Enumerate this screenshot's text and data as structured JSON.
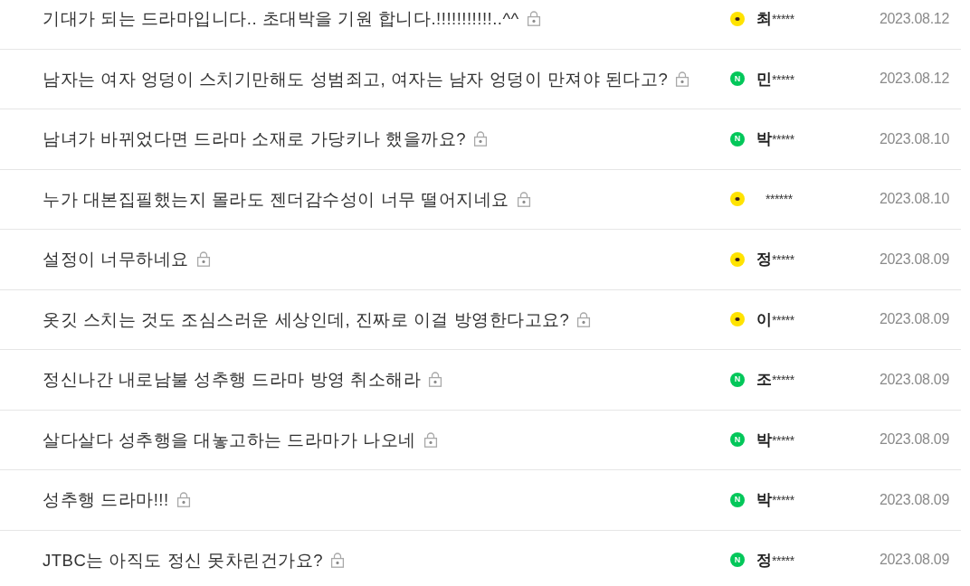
{
  "posts": [
    {
      "title": "기대가 되는 드라마입니다.. 초대박을 기원 합니다.!!!!!!!!!!!..^^",
      "locked": true,
      "author": {
        "kind": "dot",
        "initial": "최",
        "mask": "*****"
      },
      "date": "2023.08.12"
    },
    {
      "title": "남자는 여자 엉덩이 스치기만해도 성범죄고, 여자는 남자 엉덩이 만져야 된다고?",
      "locked": true,
      "author": {
        "kind": "letter",
        "badge": "N",
        "initial": "민",
        "mask": "*****"
      },
      "date": "2023.08.12"
    },
    {
      "title": "남녀가 바뀌었다면 드라마 소재로 가당키나 했을까요?",
      "locked": true,
      "author": {
        "kind": "letter",
        "badge": "N",
        "initial": "박",
        "mask": "*****"
      },
      "date": "2023.08.10"
    },
    {
      "title": "누가 대본집필했는지 몰라도 젠더감수성이 너무 떨어지네요",
      "locked": true,
      "author": {
        "kind": "dot",
        "mask": "******"
      },
      "date": "2023.08.10"
    },
    {
      "title": "설정이 너무하네요",
      "locked": true,
      "author": {
        "kind": "dot",
        "initial": "정",
        "mask": "*****"
      },
      "date": "2023.08.09"
    },
    {
      "title": "옷깃 스치는 것도 조심스러운 세상인데, 진짜로 이걸 방영한다고요?",
      "locked": true,
      "author": {
        "kind": "dot",
        "initial": "이",
        "mask": "*****"
      },
      "date": "2023.08.09"
    },
    {
      "title": "정신나간 내로남불 성추행 드라마 방영 취소해라",
      "locked": true,
      "author": {
        "kind": "letter",
        "badge": "N",
        "initial": "조",
        "mask": "*****"
      },
      "date": "2023.08.09"
    },
    {
      "title": "살다살다 성추행을 대놓고하는 드라마가 나오네",
      "locked": true,
      "author": {
        "kind": "letter",
        "badge": "N",
        "initial": "박",
        "mask": "*****"
      },
      "date": "2023.08.09"
    },
    {
      "title": "성추행 드라마!!!",
      "locked": true,
      "author": {
        "kind": "letter",
        "badge": "N",
        "initial": "박",
        "mask": "*****"
      },
      "date": "2023.08.09"
    },
    {
      "title": "JTBC는 아직도 정신 못차린건가요?",
      "locked": true,
      "author": {
        "kind": "letter",
        "badge": "N",
        "initial": "정",
        "mask": "*****"
      },
      "date": "2023.08.09"
    }
  ]
}
